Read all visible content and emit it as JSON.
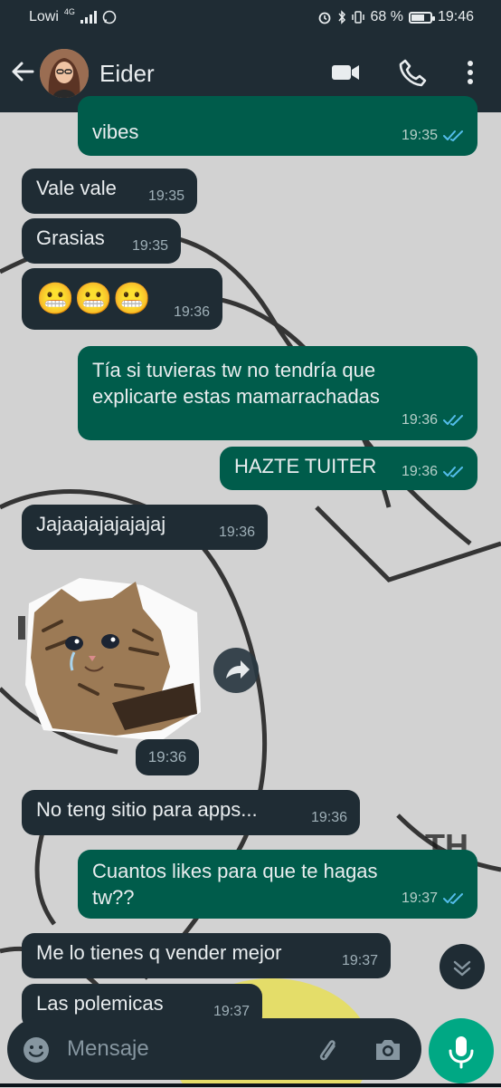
{
  "status_bar": {
    "carrier": "Lowi",
    "network": "4G",
    "battery": "68 %",
    "battery_level": 0.68,
    "time": "19:46"
  },
  "header": {
    "back_icon": "arrow-left-icon",
    "contact_name": "Eider",
    "icons": [
      "video-call-icon",
      "phone-call-icon",
      "more-vertical-icon"
    ]
  },
  "messages": [
    {
      "dir": "out",
      "text": "vibes",
      "time": "19:35",
      "read": true
    },
    {
      "dir": "in",
      "text": "Vale vale",
      "time": "19:35"
    },
    {
      "dir": "in",
      "text": "Grasias",
      "time": "19:35"
    },
    {
      "dir": "in",
      "text": "😬😬😬",
      "time": "19:36"
    },
    {
      "dir": "out",
      "text": "Tía si tuvieras tw no tendría que explicarte estas mamarrachadas",
      "time": "19:36",
      "read": true
    },
    {
      "dir": "out",
      "text": "HAZTE TUITER",
      "time": "19:36",
      "read": true
    },
    {
      "dir": "in",
      "text": "Jajaajajajajajaj",
      "time": "19:36"
    },
    {
      "dir": "in",
      "type": "sticker",
      "time": "19:36"
    },
    {
      "dir": "in",
      "text": "No teng sitio para apps...",
      "time": "19:36"
    },
    {
      "dir": "out",
      "text": "Cuantos likes para que te hagas tw??",
      "time": "19:37",
      "read": true
    },
    {
      "dir": "in",
      "text": "Me lo tienes q vender mejor",
      "time": "19:37"
    },
    {
      "dir": "in",
      "text": "Las polemicas",
      "time": "19:37"
    }
  ],
  "composer": {
    "placeholder": "Mensaje",
    "icons": [
      "emoji-icon",
      "attach-icon",
      "camera-icon",
      "mic-icon"
    ]
  },
  "colors": {
    "bar_bg": "#1f2c34",
    "incoming_bubble": "#1f2c34",
    "outgoing_bubble": "#005c4b",
    "read_ticks": "#53bdeb",
    "mic_button": "#00a884",
    "wallpaper": "#cfcfcf"
  }
}
